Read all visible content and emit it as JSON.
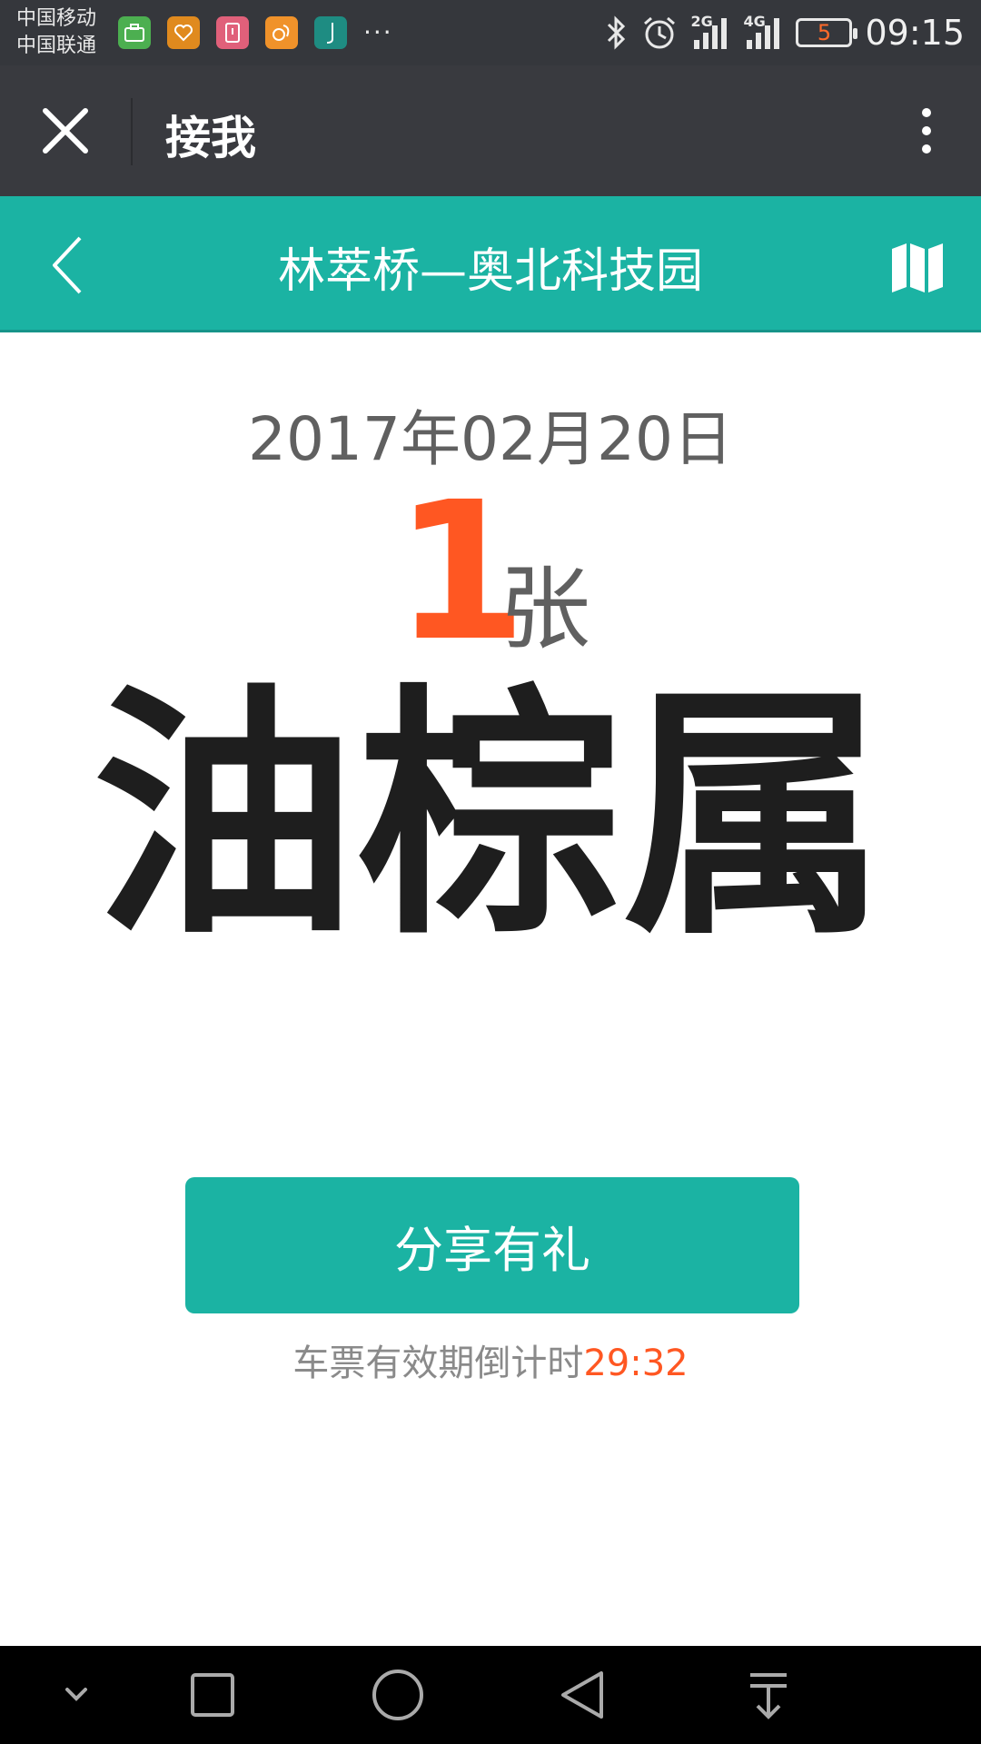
{
  "status_bar": {
    "carrier_1": "中国移动",
    "carrier_2": "中国联通",
    "app_icons": [
      {
        "name": "briefcase-icon",
        "color": "#4caf50"
      },
      {
        "name": "heart-icon",
        "color": "#e08a1e"
      },
      {
        "name": "alert-icon",
        "color": "#e0607a"
      },
      {
        "name": "squirrel-icon",
        "color": "#f0922a"
      },
      {
        "name": "bracket-icon",
        "color": "#1e8c82"
      }
    ],
    "more_notifications": "···",
    "signal_1_label": "2G",
    "signal_2_label": "4G",
    "battery_level": "5",
    "time": "09:15"
  },
  "wechat_bar": {
    "title": "接我"
  },
  "header": {
    "route_title": "林萃桥—奥北科技园"
  },
  "ticket": {
    "date": "2017年02月20日",
    "count": "1",
    "count_unit": "张",
    "code_word": "油棕属"
  },
  "actions": {
    "share_label": "分享有礼",
    "countdown_label": "车票有效期倒计时",
    "countdown_value": "29:32"
  },
  "colors": {
    "accent": "#1bb3a3",
    "highlight": "#ff5722"
  }
}
